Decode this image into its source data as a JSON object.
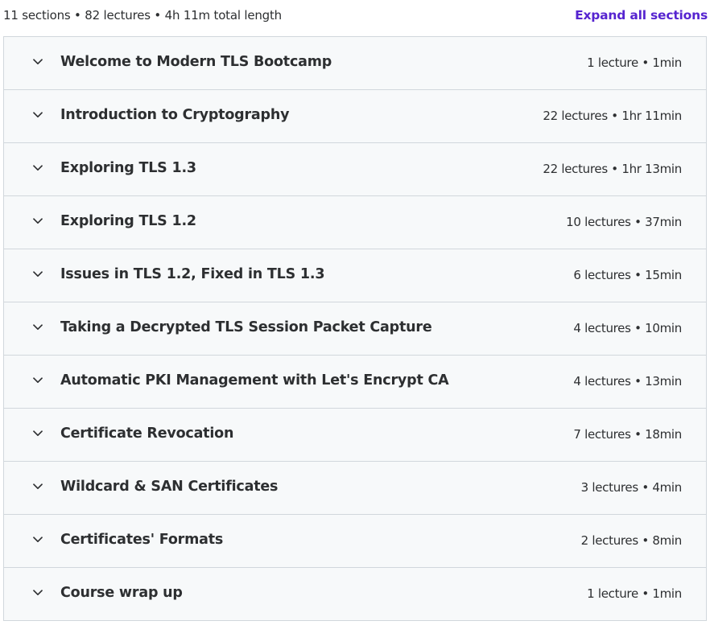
{
  "header": {
    "summary": "11 sections • 82 lectures • 4h 11m total length",
    "expand_all_label": "Expand all sections"
  },
  "sections": [
    {
      "title": "Welcome to Modern TLS Bootcamp",
      "meta": "1 lecture • 1min"
    },
    {
      "title": "Introduction to Cryptography",
      "meta": "22 lectures • 1hr 11min"
    },
    {
      "title": "Exploring TLS 1.3",
      "meta": "22 lectures • 1hr 13min"
    },
    {
      "title": "Exploring TLS 1.2",
      "meta": "10 lectures • 37min"
    },
    {
      "title": "Issues in TLS 1.2, Fixed in TLS 1.3",
      "meta": "6 lectures • 15min"
    },
    {
      "title": "Taking a Decrypted TLS Session Packet Capture",
      "meta": "4 lectures • 10min"
    },
    {
      "title": "Automatic PKI Management with Let's Encrypt CA",
      "meta": "4 lectures • 13min"
    },
    {
      "title": "Certificate Revocation",
      "meta": "7 lectures • 18min"
    },
    {
      "title": "Wildcard & SAN Certificates",
      "meta": "3 lectures • 4min"
    },
    {
      "title": "Certificates' Formats",
      "meta": "2 lectures • 8min"
    },
    {
      "title": "Course wrap up",
      "meta": "1 lecture • 1min"
    }
  ],
  "icons": {
    "section_toggle": "chevron-down-icon"
  },
  "colors": {
    "accent": "#5624d0",
    "text": "#2d2f31",
    "row_bg": "#f7f9fa",
    "border": "#d1d7dc"
  }
}
